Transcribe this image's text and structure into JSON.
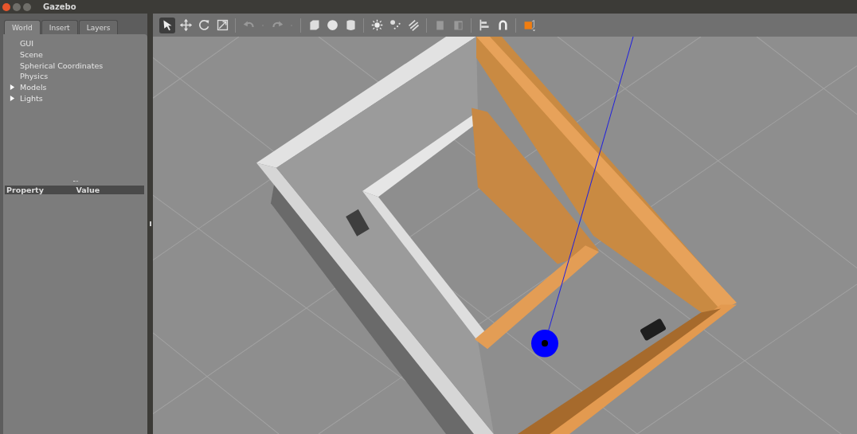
{
  "window": {
    "title": "Gazebo"
  },
  "tabs": [
    {
      "label": "World",
      "selected": true
    },
    {
      "label": "Insert",
      "selected": false
    },
    {
      "label": "Layers",
      "selected": false
    }
  ],
  "tree": [
    {
      "label": "GUI",
      "kind": "leaf"
    },
    {
      "label": "Scene",
      "kind": "leaf"
    },
    {
      "label": "Spherical Coordinates",
      "kind": "leaf"
    },
    {
      "label": "Physics",
      "kind": "leaf"
    },
    {
      "label": "Models",
      "kind": "group",
      "expanded": false
    },
    {
      "label": "Lights",
      "kind": "group",
      "expanded": false
    }
  ],
  "properties": {
    "columns": [
      "Property",
      "Value"
    ]
  },
  "toolbar": [
    {
      "kind": "select",
      "selected": true
    },
    {
      "kind": "translate",
      "selected": false
    },
    {
      "kind": "rotate",
      "selected": false
    },
    {
      "kind": "scale",
      "selected": false
    },
    {
      "kind": "sep"
    },
    {
      "kind": "undo"
    },
    {
      "kind": "dropdown"
    },
    {
      "kind": "redo"
    },
    {
      "kind": "dropdown"
    },
    {
      "kind": "sep"
    },
    {
      "kind": "box"
    },
    {
      "kind": "sphere"
    },
    {
      "kind": "cylinder"
    },
    {
      "kind": "sep"
    },
    {
      "kind": "pointlight"
    },
    {
      "kind": "spotlight"
    },
    {
      "kind": "dirlight"
    },
    {
      "kind": "sep"
    },
    {
      "kind": "copy"
    },
    {
      "kind": "paste"
    },
    {
      "kind": "sep"
    },
    {
      "kind": "align"
    },
    {
      "kind": "magnet"
    },
    {
      "kind": "sep"
    },
    {
      "kind": "view"
    }
  ]
}
